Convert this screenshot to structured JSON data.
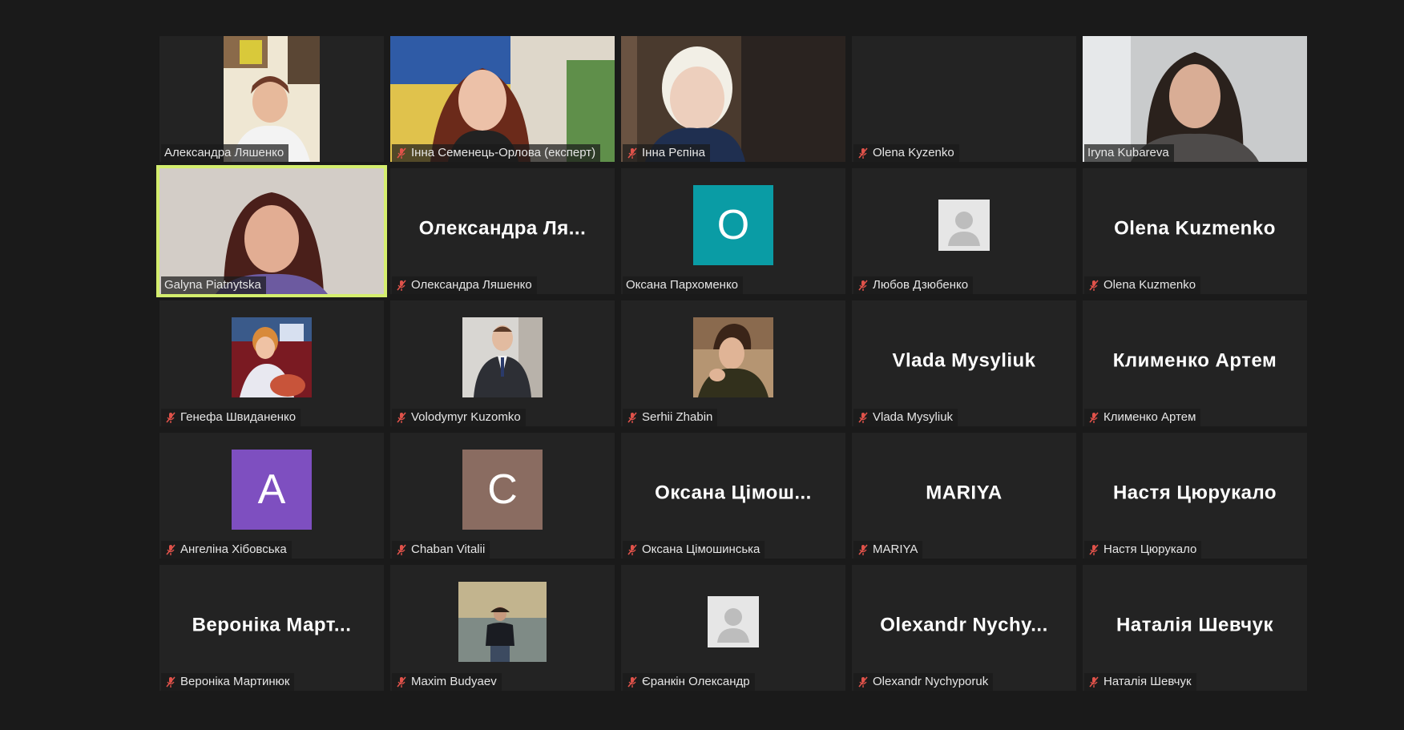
{
  "participants": [
    {
      "name": "Александра Ляшенко",
      "muted": false,
      "type": "video"
    },
    {
      "name": "Інна Семенець-Орлова (експерт)",
      "muted": true,
      "type": "video"
    },
    {
      "name": "Інна Рєпіна",
      "muted": true,
      "type": "video"
    },
    {
      "name": "Olena Kyzenko",
      "muted": true,
      "type": "blank"
    },
    {
      "name": "Iryna Kubareva",
      "muted": false,
      "type": "video"
    },
    {
      "name": "Galyna Piatnytska",
      "muted": false,
      "type": "video",
      "active_speaker": true
    },
    {
      "name": "Олександра Ляшенко",
      "display": "Олександра Ля...",
      "muted": true,
      "type": "name"
    },
    {
      "name": "Оксана Пархоменко",
      "muted": false,
      "type": "letter",
      "letter": "O",
      "color": "#0a9ca5"
    },
    {
      "name": "Любов Дзюбенко",
      "muted": true,
      "type": "generic-avatar"
    },
    {
      "name": "Olena Kuzmenko",
      "display": "Olena Kuzmenko",
      "muted": true,
      "type": "name"
    },
    {
      "name": "Генефа Швиданенко",
      "muted": true,
      "type": "photo"
    },
    {
      "name": "Volodymyr Kuzomko",
      "muted": true,
      "type": "photo"
    },
    {
      "name": "Serhii Zhabin",
      "muted": true,
      "type": "photo"
    },
    {
      "name": "Vlada Mysyliuk",
      "display": "Vlada Mysyliuk",
      "muted": true,
      "type": "name"
    },
    {
      "name": "Клименко Артем",
      "display": "Клименко Артем",
      "muted": true,
      "type": "name"
    },
    {
      "name": "Ангеліна Хібовська",
      "muted": true,
      "type": "letter",
      "letter": "A",
      "color": "#7e4fc0"
    },
    {
      "name": "Chaban Vitalii",
      "muted": true,
      "type": "letter",
      "letter": "C",
      "color": "#8a6c61"
    },
    {
      "name": "Оксана Цімошинська",
      "display": "Оксана Цімош...",
      "muted": true,
      "type": "name"
    },
    {
      "name": "MARIYA",
      "display": "MARIYA",
      "muted": true,
      "type": "name"
    },
    {
      "name": "Настя Цюрукало",
      "display": "Настя Цюрукало",
      "muted": true,
      "type": "name"
    },
    {
      "name": "Вероніка Мартинюк",
      "display": "Вероніка Март...",
      "muted": true,
      "type": "name"
    },
    {
      "name": "Maxim Budyaev",
      "muted": true,
      "type": "photo"
    },
    {
      "name": "Єранкін Олександр",
      "muted": true,
      "type": "generic-avatar"
    },
    {
      "name": "Olexandr Nychyporuk",
      "display": "Olexandr  Nychy...",
      "muted": true,
      "type": "name"
    },
    {
      "name": "Наталія Шевчук",
      "display": "Наталія Шевчук",
      "muted": true,
      "type": "name"
    }
  ],
  "colors": {
    "background": "#1a1a1a",
    "tile": "#232323",
    "active_speaker_border": "#d4ee6e",
    "muted_icon": "#e0524a"
  }
}
